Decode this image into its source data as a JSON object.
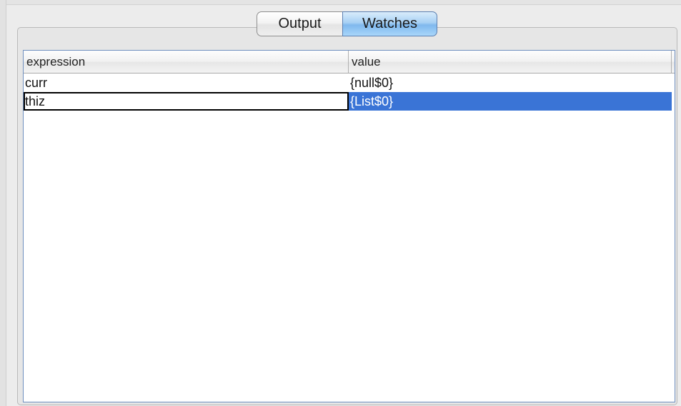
{
  "tabs": [
    {
      "label": "Output",
      "selected": false
    },
    {
      "label": "Watches",
      "selected": true
    }
  ],
  "table": {
    "columns": [
      "expression",
      "value"
    ],
    "rows": [
      {
        "expression": "curr",
        "value": "{null$0}",
        "selected": false
      },
      {
        "expression": "thiz",
        "value": "{List$0}",
        "selected": true
      }
    ]
  },
  "colors": {
    "selection": "#3a74d6",
    "tab_active": "#7fb8ee"
  }
}
